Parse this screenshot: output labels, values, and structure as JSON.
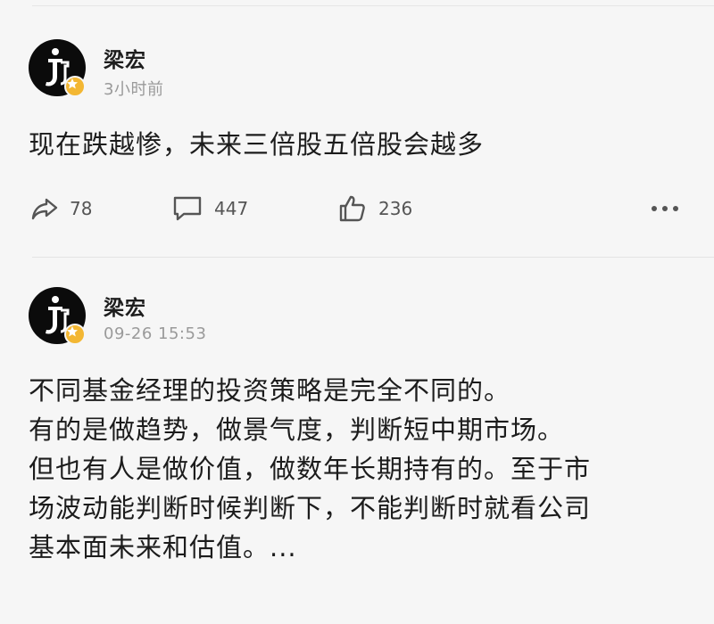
{
  "posts": [
    {
      "author": "梁宏",
      "time": "3小时前",
      "content": "现在跌越惨，未来三倍股五倍股会越多",
      "actions": {
        "share_count": "78",
        "comment_count": "447",
        "like_count": "236"
      }
    },
    {
      "author": "梁宏",
      "time": "09-26 15:53",
      "content_lines": [
        "不同基金经理的投资策略是完全不同的。",
        "有的是做趋势，做景气度，判断短中期市场。",
        "但也有人是做价值，做数年长期持有的。至于市",
        "场波动能判断时候判断下，不能判断时就看公司",
        "基本面未来和估值。..."
      ]
    }
  ],
  "icons": {
    "avatar_logo": "jj-logo-icon",
    "badge": "verified-star-badge-icon",
    "share": "share-arrow-icon",
    "comment": "comment-bubble-icon",
    "like": "thumbs-up-icon",
    "more": "more-dots-icon"
  },
  "colors": {
    "badge": "#f3b733",
    "avatar_bg": "#0b0b0b",
    "muted_text": "#9a9a9a"
  }
}
